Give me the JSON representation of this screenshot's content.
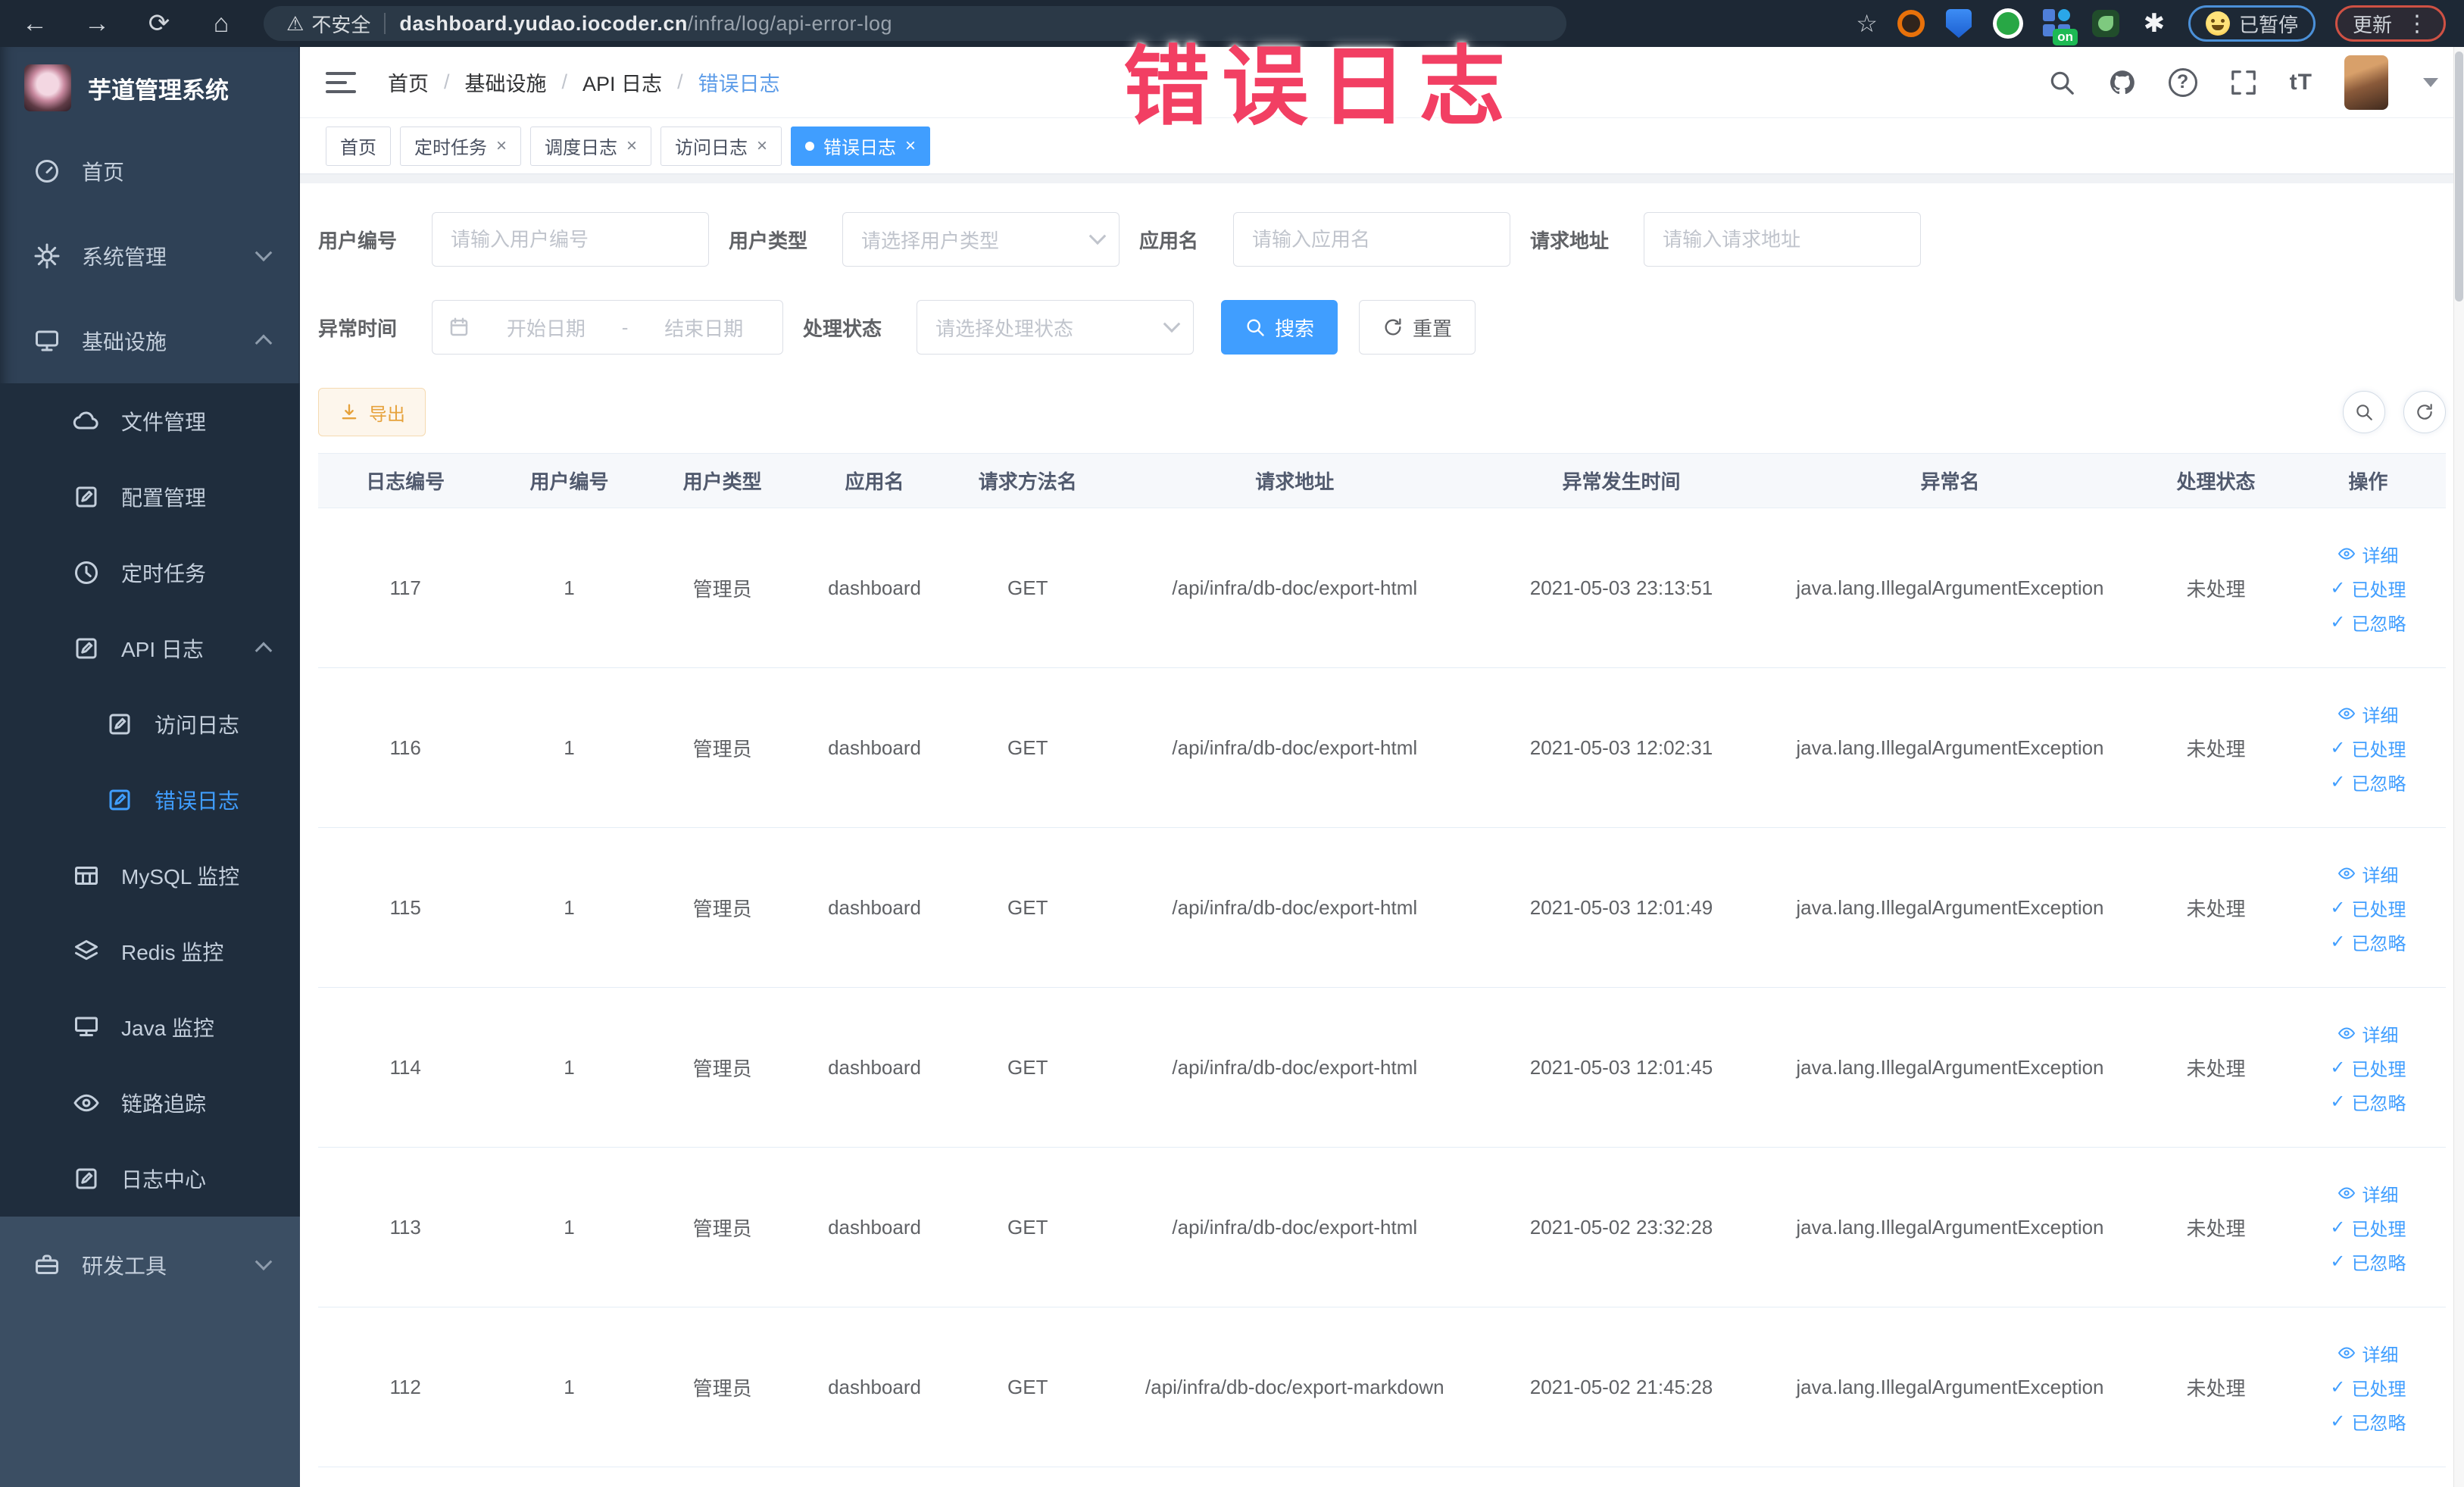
{
  "browser": {
    "security_label": "不安全",
    "url_domain": "dashboard.yudao.iocoder.cn",
    "url_path": "/infra/log/api-error-log",
    "paused_label": "已暂停",
    "update_label": "更新",
    "ext_on_badge": "on"
  },
  "icons": {
    "back": "←",
    "forward": "→",
    "reload": "⟳",
    "home": "⌂",
    "warning": "⚠",
    "star": "☆",
    "dots_v": "⋮",
    "close": "×",
    "check": "✓",
    "question": "?",
    "font_size": "tT",
    "puzzle": "✱"
  },
  "overlay_title": "错误日志",
  "sidebar": {
    "app_title": "芋道管理系统",
    "items": [
      {
        "label": "首页"
      },
      {
        "label": "系统管理"
      },
      {
        "label": "基础设施"
      },
      {
        "label": "文件管理"
      },
      {
        "label": "配置管理"
      },
      {
        "label": "定时任务"
      },
      {
        "label": "API 日志"
      },
      {
        "label": "访问日志"
      },
      {
        "label": "错误日志"
      },
      {
        "label": "MySQL 监控"
      },
      {
        "label": "Redis 监控"
      },
      {
        "label": "Java 监控"
      },
      {
        "label": "链路追踪"
      },
      {
        "label": "日志中心"
      },
      {
        "label": "研发工具"
      }
    ]
  },
  "breadcrumb": {
    "items": [
      "首页",
      "基础设施",
      "API 日志",
      "错误日志"
    ]
  },
  "tabs": [
    {
      "label": "首页"
    },
    {
      "label": "定时任务"
    },
    {
      "label": "调度日志"
    },
    {
      "label": "访问日志"
    },
    {
      "label": "错误日志"
    }
  ],
  "filters": {
    "user_id": {
      "label": "用户编号",
      "placeholder": "请输入用户编号"
    },
    "user_type": {
      "label": "用户类型",
      "placeholder": "请选择用户类型"
    },
    "app_name": {
      "label": "应用名",
      "placeholder": "请输入应用名"
    },
    "request_url": {
      "label": "请求地址",
      "placeholder": "请输入请求地址"
    },
    "exception_time": {
      "label": "异常时间",
      "start_placeholder": "开始日期",
      "separator": "-",
      "end_placeholder": "结束日期"
    },
    "process_status": {
      "label": "处理状态",
      "placeholder": "请选择处理状态"
    },
    "search_label": "搜索",
    "reset_label": "重置"
  },
  "toolbar": {
    "export_label": "导出"
  },
  "table": {
    "columns": [
      "日志编号",
      "用户编号",
      "用户类型",
      "应用名",
      "请求方法名",
      "请求地址",
      "异常发生时间",
      "异常名",
      "处理状态",
      "操作"
    ],
    "actions": [
      "详细",
      "已处理",
      "已忽略"
    ],
    "rows": [
      {
        "id": "117",
        "user_id": "1",
        "user_type": "管理员",
        "app": "dashboard",
        "method": "GET",
        "url": "/api/infra/db-doc/export-html",
        "time": "2021-05-03 23:13:51",
        "exception": "java.lang.IllegalArgumentException",
        "status": "未处理"
      },
      {
        "id": "116",
        "user_id": "1",
        "user_type": "管理员",
        "app": "dashboard",
        "method": "GET",
        "url": "/api/infra/db-doc/export-html",
        "time": "2021-05-03 12:02:31",
        "exception": "java.lang.IllegalArgumentException",
        "status": "未处理"
      },
      {
        "id": "115",
        "user_id": "1",
        "user_type": "管理员",
        "app": "dashboard",
        "method": "GET",
        "url": "/api/infra/db-doc/export-html",
        "time": "2021-05-03 12:01:49",
        "exception": "java.lang.IllegalArgumentException",
        "status": "未处理"
      },
      {
        "id": "114",
        "user_id": "1",
        "user_type": "管理员",
        "app": "dashboard",
        "method": "GET",
        "url": "/api/infra/db-doc/export-html",
        "time": "2021-05-03 12:01:45",
        "exception": "java.lang.IllegalArgumentException",
        "status": "未处理"
      },
      {
        "id": "113",
        "user_id": "1",
        "user_type": "管理员",
        "app": "dashboard",
        "method": "GET",
        "url": "/api/infra/db-doc/export-html",
        "time": "2021-05-02 23:32:28",
        "exception": "java.lang.IllegalArgumentException",
        "status": "未处理"
      },
      {
        "id": "112",
        "user_id": "1",
        "user_type": "管理员",
        "app": "dashboard",
        "method": "GET",
        "url": "/api/infra/db-doc/export-markdown",
        "time": "2021-05-02 21:45:28",
        "exception": "java.lang.IllegalArgumentException",
        "status": "未处理"
      }
    ]
  },
  "colors": {
    "accent": "#409eff",
    "warning": "#e6a23c",
    "annotation": "#f23f63",
    "sidebar_bg": "#2f4156",
    "submenu_bg": "#1f2d3d"
  }
}
